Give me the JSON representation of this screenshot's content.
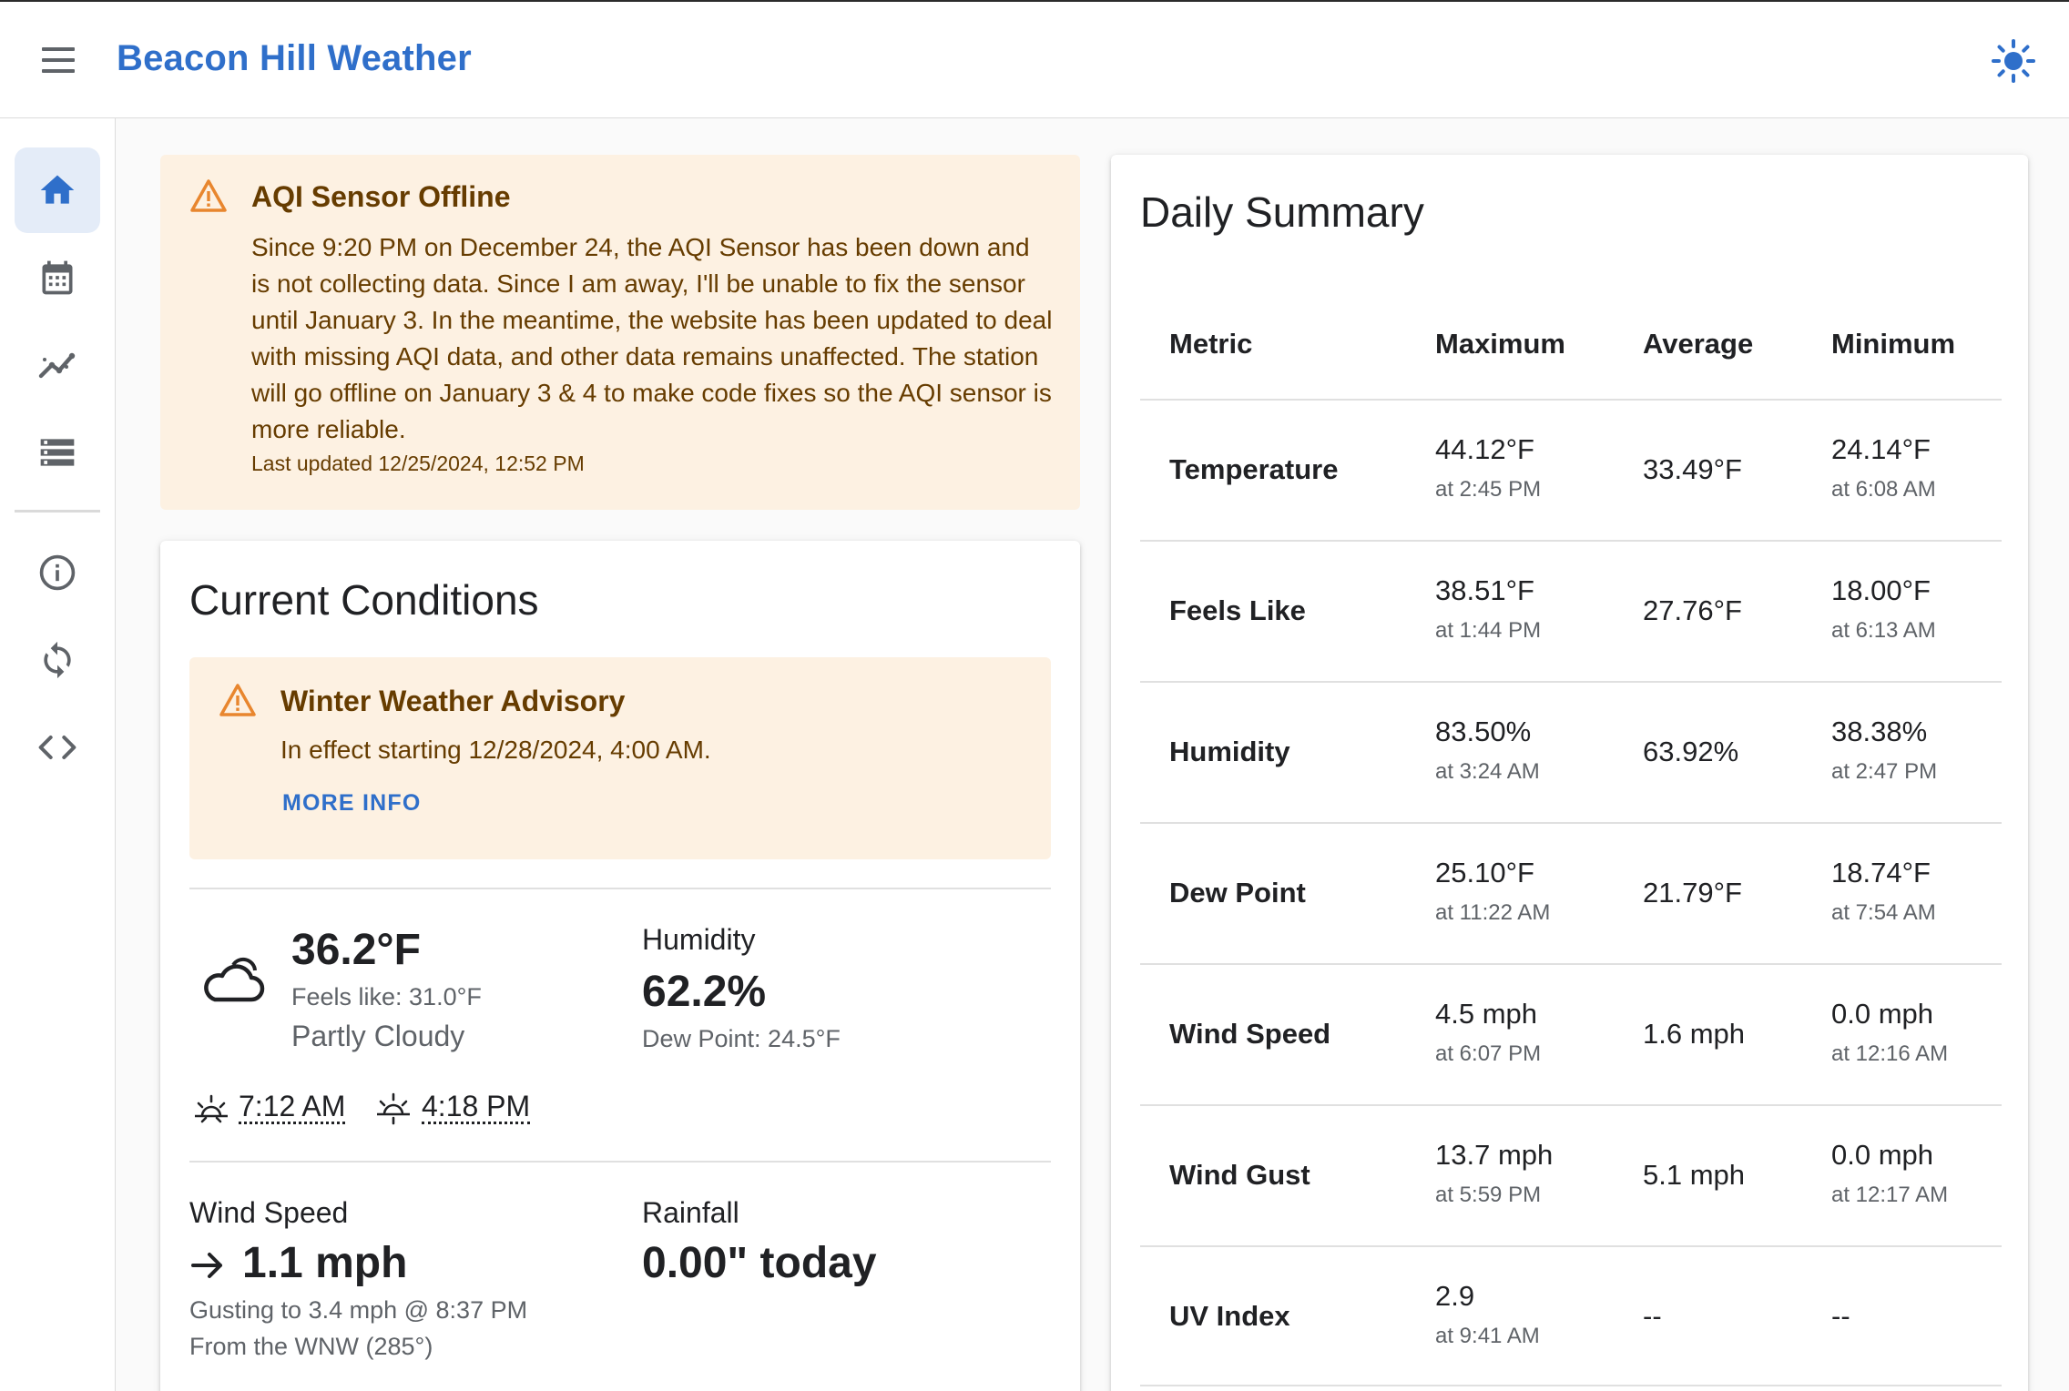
{
  "app": {
    "title": "Beacon Hill Weather"
  },
  "nav": {
    "items": [
      {
        "name": "home",
        "icon": "home-icon"
      },
      {
        "name": "calendar",
        "icon": "calendar-icon"
      },
      {
        "name": "trends",
        "icon": "trending-icon"
      },
      {
        "name": "data",
        "icon": "storage-icon"
      },
      {
        "name": "about",
        "icon": "info-icon"
      },
      {
        "name": "refresh",
        "icon": "sync-icon"
      },
      {
        "name": "source",
        "icon": "code-icon"
      }
    ]
  },
  "alert": {
    "title": "AQI Sensor Offline",
    "body": "Since 9:20 PM on December 24, the AQI Sensor has been down and is not collecting data. Since I am away, I'll be unable to fix the sensor until January 3. In the meantime, the website has been updated to deal with missing AQI data, and other data remains unaffected. The station will go offline on January 3 & 4 to make code fixes so the AQI sensor is more reliable.",
    "updated": "Last updated 12/25/2024, 12:52 PM"
  },
  "current": {
    "title": "Current Conditions",
    "advisory": {
      "title": "Winter Weather Advisory",
      "body": "In effect starting 12/28/2024, 4:00 AM.",
      "link": "MORE INFO"
    },
    "temperature": "36.2°F",
    "feels_like": "Feels like: 31.0°F",
    "condition": "Partly Cloudy",
    "humidity_label": "Humidity",
    "humidity": "62.2%",
    "dew_point": "Dew Point: 24.5°F",
    "sunrise": "7:12 AM",
    "sunset": "4:18 PM",
    "wind_label": "Wind Speed",
    "wind": "1.1 mph",
    "gust": "Gusting to 3.4 mph @ 8:37 PM",
    "direction": "From the WNW (285°)",
    "rain_label": "Rainfall",
    "rain": "0.00\" today"
  },
  "summary": {
    "title": "Daily Summary",
    "headers": {
      "metric": "Metric",
      "max": "Maximum",
      "avg": "Average",
      "min": "Minimum"
    },
    "rows": [
      {
        "metric": "Temperature",
        "max": "44.12°F",
        "max_time": "at 2:45 PM",
        "avg": "33.49°F",
        "min": "24.14°F",
        "min_time": "at 6:08 AM"
      },
      {
        "metric": "Feels Like",
        "max": "38.51°F",
        "max_time": "at 1:44 PM",
        "avg": "27.76°F",
        "min": "18.00°F",
        "min_time": "at 6:13 AM"
      },
      {
        "metric": "Humidity",
        "max": "83.50%",
        "max_time": "at 3:24 AM",
        "avg": "63.92%",
        "min": "38.38%",
        "min_time": "at 2:47 PM"
      },
      {
        "metric": "Dew Point",
        "max": "25.10°F",
        "max_time": "at 11:22 AM",
        "avg": "21.79°F",
        "min": "18.74°F",
        "min_time": "at 7:54 AM"
      },
      {
        "metric": "Wind Speed",
        "max": "4.5 mph",
        "max_time": "at 6:07 PM",
        "avg": "1.6 mph",
        "min": "0.0 mph",
        "min_time": "at 12:16 AM"
      },
      {
        "metric": "Wind Gust",
        "max": "13.7 mph",
        "max_time": "at 5:59 PM",
        "avg": "5.1 mph",
        "min": "0.0 mph",
        "min_time": "at 12:17 AM"
      },
      {
        "metric": "UV Index",
        "max": "2.9",
        "max_time": "at 9:41 AM",
        "avg": "--",
        "min": "--",
        "min_time": ""
      }
    ]
  },
  "colors": {
    "brand": "#2f6fca",
    "warning_bg": "#fdf1e2",
    "warning_text": "#663c00",
    "warning_icon": "#e8862e"
  }
}
